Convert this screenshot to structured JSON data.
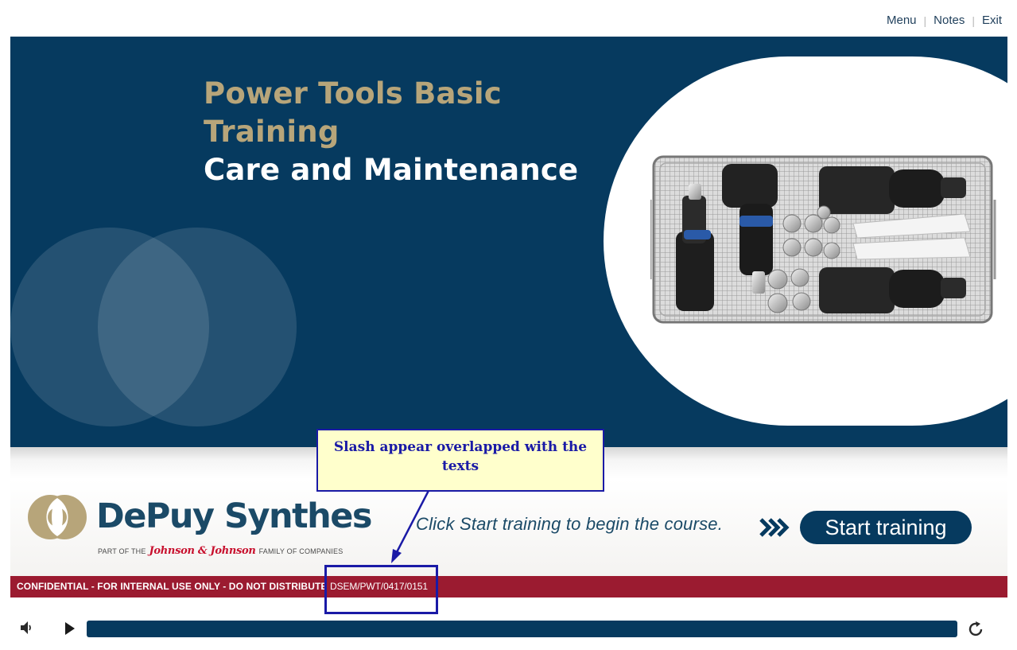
{
  "nav": {
    "menu": "Menu",
    "notes": "Notes",
    "exit": "Exit",
    "separator": "|"
  },
  "slide": {
    "title_line1": "Power Tools Basic",
    "title_line2": "Training",
    "subtitle": "Care and Maintenance",
    "brand": "DePuy Synthes",
    "brand_sub_prefix": "PART OF THE",
    "brand_sub_jj": "Johnson & Johnson",
    "brand_sub_suffix": "FAMILY OF COMPANIES",
    "instruction": "Click Start training to begin the course.",
    "start_button": "Start training",
    "confidential": "CONFIDENTIAL - FOR INTERNAL USE ONLY - DO NOT DISTRIBUTE",
    "code": "DSEM/PWT/0417/0151"
  },
  "annotation": {
    "callout_text": "Slash appear overlapped with the texts"
  },
  "player": {
    "progress": 0.0
  },
  "icons": {
    "volume": "volume-icon",
    "play": "play-icon",
    "replay": "replay-icon",
    "chevrons": "triple-chevron-icon"
  },
  "colors": {
    "navy": "#063a5f",
    "gold": "#b7a57a",
    "crimson": "#9b1b30",
    "annotation_blue": "#1a1aa6",
    "annotation_fill": "#ffffcc"
  }
}
